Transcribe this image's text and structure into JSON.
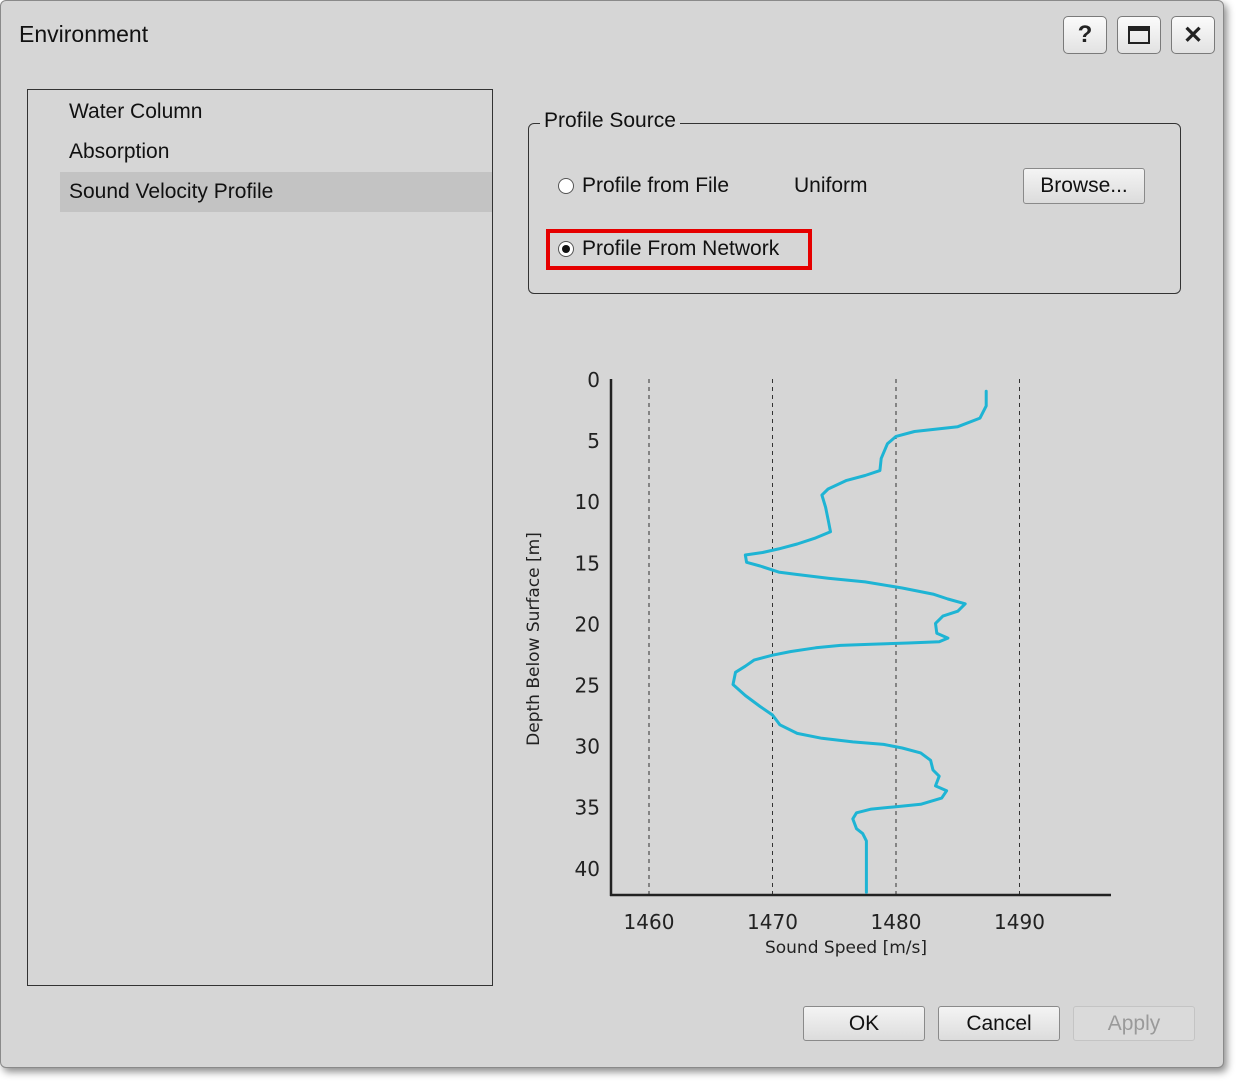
{
  "window": {
    "title": "Environment",
    "help_label": "?",
    "close_label": "✕"
  },
  "nav": {
    "items": [
      {
        "label": "Water Column",
        "selected": false
      },
      {
        "label": "Absorption",
        "selected": false
      },
      {
        "label": "Sound Velocity Profile",
        "selected": true
      }
    ]
  },
  "profile_source": {
    "legend": "Profile Source",
    "from_file_label": "Profile from File",
    "from_file_value": "Uniform",
    "browse_label": "Browse...",
    "from_network_label": "Profile From Network",
    "selected": "network",
    "highlight_color": "#e60000"
  },
  "chart_data": {
    "type": "line",
    "xlabel": "Sound Speed [m/s]",
    "ylabel": "Depth Below Surface [m]",
    "xlim": [
      1457,
      1497
    ],
    "ylim": [
      0,
      42
    ],
    "y_inverted": true,
    "xticks": [
      1460,
      1470,
      1480,
      1490
    ],
    "yticks": [
      0,
      5,
      10,
      15,
      20,
      25,
      30,
      35,
      40
    ],
    "grid": "vertical dashed",
    "line_color": "#1eb4d4",
    "series": [
      {
        "points": [
          [
            1487.3,
            1.0
          ],
          [
            1487.3,
            2.2
          ],
          [
            1486.8,
            3.2
          ],
          [
            1485.0,
            3.9
          ],
          [
            1481.5,
            4.3
          ],
          [
            1480.0,
            4.7
          ],
          [
            1479.3,
            5.3
          ],
          [
            1478.8,
            6.5
          ],
          [
            1478.7,
            7.5
          ],
          [
            1477.5,
            7.9
          ],
          [
            1476.0,
            8.3
          ],
          [
            1474.5,
            9.0
          ],
          [
            1474.0,
            9.5
          ],
          [
            1474.3,
            10.5
          ],
          [
            1474.5,
            11.5
          ],
          [
            1474.7,
            12.5
          ],
          [
            1473.5,
            13.0
          ],
          [
            1472.0,
            13.5
          ],
          [
            1470.5,
            13.9
          ],
          [
            1469.2,
            14.2
          ],
          [
            1467.8,
            14.4
          ],
          [
            1467.9,
            15.0
          ],
          [
            1469.0,
            15.3
          ],
          [
            1470.5,
            15.8
          ],
          [
            1472.0,
            16.0
          ],
          [
            1474.5,
            16.3
          ],
          [
            1477.5,
            16.6
          ],
          [
            1480.5,
            17.1
          ],
          [
            1483.0,
            17.6
          ],
          [
            1484.2,
            18.0
          ],
          [
            1485.6,
            18.4
          ],
          [
            1485.0,
            19.0
          ],
          [
            1483.8,
            19.4
          ],
          [
            1483.2,
            20.0
          ],
          [
            1483.3,
            20.8
          ],
          [
            1484.2,
            21.2
          ],
          [
            1483.5,
            21.5
          ],
          [
            1481.0,
            21.6
          ],
          [
            1478.0,
            21.7
          ],
          [
            1475.5,
            21.8
          ],
          [
            1473.5,
            22.0
          ],
          [
            1471.5,
            22.3
          ],
          [
            1470.0,
            22.6
          ],
          [
            1468.5,
            23.0
          ],
          [
            1467.8,
            23.5
          ],
          [
            1467.0,
            24.0
          ],
          [
            1466.8,
            25.0
          ],
          [
            1467.8,
            25.9
          ],
          [
            1469.0,
            26.8
          ],
          [
            1470.0,
            27.5
          ],
          [
            1470.6,
            28.3
          ],
          [
            1472.0,
            29.0
          ],
          [
            1474.0,
            29.4
          ],
          [
            1476.5,
            29.7
          ],
          [
            1479.0,
            29.9
          ],
          [
            1480.5,
            30.2
          ],
          [
            1482.0,
            30.6
          ],
          [
            1482.8,
            31.2
          ],
          [
            1483.0,
            32.0
          ],
          [
            1483.5,
            32.5
          ],
          [
            1483.2,
            33.3
          ],
          [
            1484.1,
            33.7
          ],
          [
            1483.7,
            34.3
          ],
          [
            1482.0,
            34.8
          ],
          [
            1480.0,
            35.0
          ],
          [
            1478.0,
            35.2
          ],
          [
            1476.8,
            35.5
          ],
          [
            1476.5,
            36.0
          ],
          [
            1476.8,
            36.8
          ],
          [
            1477.3,
            37.2
          ],
          [
            1477.6,
            37.8
          ],
          [
            1477.6,
            38.5
          ],
          [
            1477.6,
            39.5
          ],
          [
            1477.6,
            40.5
          ],
          [
            1477.6,
            42.0
          ]
        ]
      }
    ]
  },
  "actions": {
    "ok": "OK",
    "cancel": "Cancel",
    "apply": "Apply",
    "apply_enabled": false
  }
}
